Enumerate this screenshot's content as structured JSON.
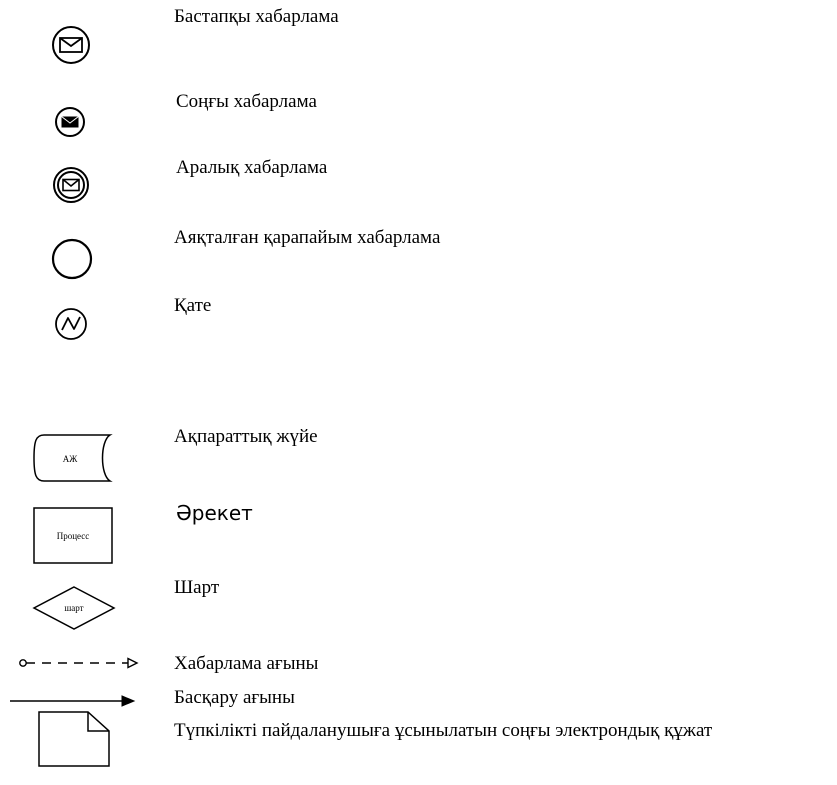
{
  "legend": {
    "start_message": "Бастапқы хабарлама",
    "end_message": "Соңғы хабарлама",
    "intermediate_message": "Аралық хабарлама",
    "simple_end": "Аяқталған қарапайым хабарлама",
    "error": "Қате",
    "info_system": "Ақпараттық жүйе",
    "info_system_short": "АЖ",
    "action": "Әрекет",
    "process_short": "Процесс",
    "condition": "Шарт",
    "condition_short": "шарт",
    "message_flow": "Хабарлама ағыны",
    "control_flow": "Басқару ағыны",
    "final_document": "Түпкілікті пайдаланушыға  ұсынылатын соңғы электрондық құжат"
  }
}
